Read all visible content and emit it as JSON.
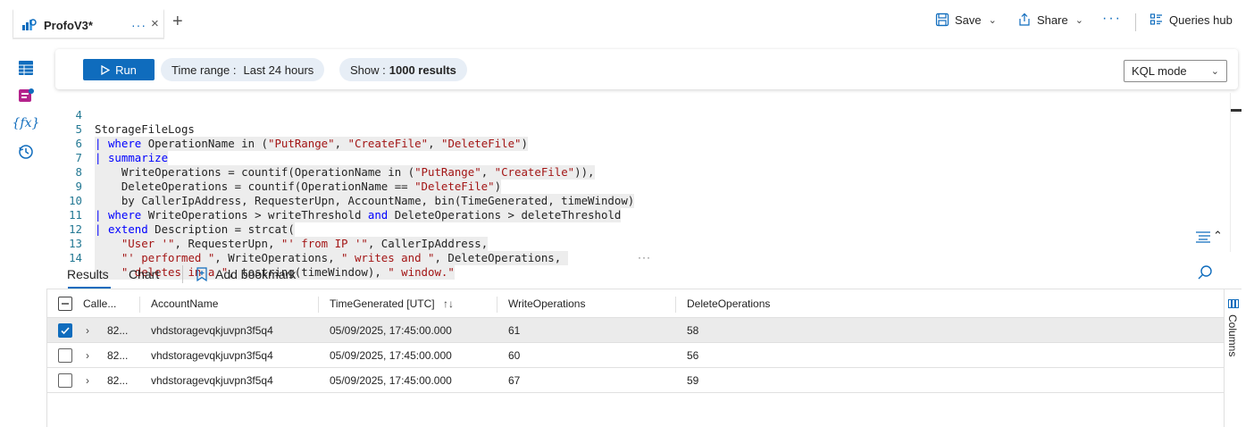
{
  "tab": {
    "title": "ProfoV3*",
    "more": "···",
    "close": "×",
    "new_tab": "+"
  },
  "toolbar": {
    "save_label": "Save",
    "share_label": "Share",
    "more_label": "···",
    "queries_hub_label": "Queries hub"
  },
  "query_bar": {
    "run_label": "Run",
    "time_range_label": "Time range :",
    "time_range_value": "Last 24 hours",
    "show_label": "Show :",
    "show_value": "1000 results",
    "mode_value": "KQL mode"
  },
  "editor": {
    "lines": [
      {
        "num": "4"
      },
      {
        "num": "5"
      },
      {
        "num": "6"
      },
      {
        "num": "7"
      },
      {
        "num": "8"
      },
      {
        "num": "9"
      },
      {
        "num": "10"
      },
      {
        "num": "11"
      },
      {
        "num": "12"
      },
      {
        "num": "13"
      },
      {
        "num": "14"
      }
    ],
    "tokens": {
      "l4": "StorageFileLogs",
      "l5_pipe": "|",
      "l5_kw": "where",
      "l5_a": " OperationName in (",
      "l5_s1": "\"PutRange\"",
      "l5_c1": ", ",
      "l5_s2": "\"CreateFile\"",
      "l5_c2": ", ",
      "l5_s3": "\"DeleteFile\"",
      "l5_end": ")",
      "l6_pipe": "|",
      "l6_kw": "summarize",
      "l7_a": "    WriteOperations = countif(OperationName in (",
      "l7_s1": "\"PutRange\"",
      "l7_c1": ", ",
      "l7_s2": "\"CreateFile\"",
      "l7_end": ")),",
      "l8_a": "    DeleteOperations = countif(OperationName == ",
      "l8_s1": "\"DeleteFile\"",
      "l8_end": ")",
      "l9_a": "    by CallerIpAddress, RequesterUpn, AccountName, bin(TimeGenerated, timeWindow)",
      "l10_pipe": "|",
      "l10_kw": "where",
      "l10_a": " WriteOperations > writeThreshold ",
      "l10_and": "and",
      "l10_b": " DeleteOperations > deleteThreshold",
      "l11_pipe": "|",
      "l11_kw": "extend",
      "l11_a": " Description = strcat(",
      "l12_pre": "    ",
      "l12_s1": "\"User '\"",
      "l12_a": ", RequesterUpn, ",
      "l12_s2": "\"' from IP '\"",
      "l12_b": ", CallerIpAddress,",
      "l13_pre": "    ",
      "l13_s1": "\"' performed \"",
      "l13_a": ", WriteOperations, ",
      "l13_s2": "\" writes and \"",
      "l13_b": ", DeleteOperations, ",
      "l14_pre": "    ",
      "l14_s1": "\" deletes in a \"",
      "l14_a": ", tostring(timeWindow), ",
      "l14_s2": "\" window.\""
    }
  },
  "results": {
    "tab_results": "Results",
    "tab_chart": "Chart",
    "add_bookmark": "Add bookmark",
    "columns_label": "Columns",
    "headers": {
      "caller": "Calle...",
      "account": "AccountName",
      "time": "TimeGenerated [UTC]",
      "writes": "WriteOperations",
      "deletes": "DeleteOperations"
    },
    "rows": [
      {
        "caller": "82...",
        "account": "vhdstoragevqkjuvpn3f5q4",
        "time": "05/09/2025, 17:45:00.000",
        "writes": "61",
        "deletes": "58",
        "checked": true
      },
      {
        "caller": "82...",
        "account": "vhdstoragevqkjuvpn3f5q4",
        "time": "05/09/2025, 17:45:00.000",
        "writes": "60",
        "deletes": "56",
        "checked": false
      },
      {
        "caller": "82...",
        "account": "vhdstoragevqkjuvpn3f5q4",
        "time": "05/09/2025, 17:45:00.000",
        "writes": "67",
        "deletes": "59",
        "checked": false
      }
    ]
  },
  "colors": {
    "accent": "#0f6cbd",
    "string": "#a31515",
    "keyword": "#0000ff",
    "line_number": "#237893"
  }
}
